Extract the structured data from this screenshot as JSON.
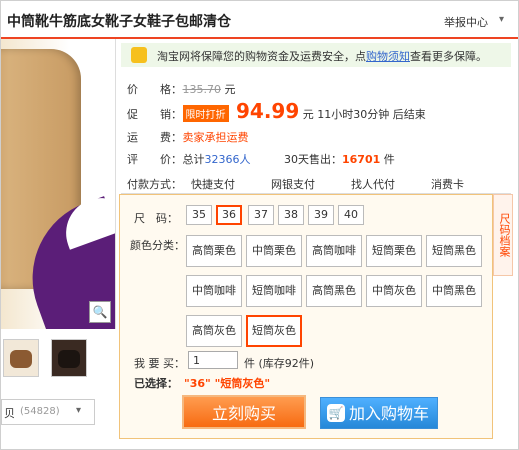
{
  "header": {
    "title": "中筒靴牛筋底女靴子女鞋子包邮清仓",
    "report": "举报中心"
  },
  "gallery": {
    "favorites_label": "贝",
    "favorites_count": "(54828)"
  },
  "guarantee": {
    "text_prefix": "淘宝网将保障您的购物资金及运费安全，点",
    "link": "购物须知",
    "text_suffix": "查看更多保障。"
  },
  "price": {
    "label": "价　　格：",
    "original": "135.70",
    "currency": "元"
  },
  "promo": {
    "label": "促　　销：",
    "badge": "限时打折",
    "price": "94.99",
    "currency": "元",
    "timer": "11小时30分钟",
    "after": "后结束"
  },
  "shipping": {
    "label": "运　　费：",
    "value": "卖家承担运费"
  },
  "reviews": {
    "label": "评　　价：",
    "prefix": "总计",
    "count": "32366人",
    "sold_label": "30天售出：",
    "sold": "16701",
    "sold_unit": "件"
  },
  "payment": {
    "label": "付款方式：",
    "options": [
      "快捷支付",
      "网银支付",
      "找人代付",
      "消费卡"
    ]
  },
  "sku": {
    "size_label": "尺　码：",
    "sizes": [
      "35",
      "36",
      "37",
      "38",
      "39",
      "40"
    ],
    "selected_size_index": 1,
    "color_label": "颜色分类：",
    "colors": [
      "高筒栗色",
      "中筒栗色",
      "高筒咖啡",
      "短筒栗色",
      "短筒黑色",
      "中筒咖啡",
      "短筒咖啡",
      "高筒黑色",
      "中筒灰色",
      "中筒黑色",
      "高筒灰色",
      "短筒灰色"
    ],
    "selected_color_index": 11,
    "qty_label": "我 要 买：",
    "qty": "1",
    "stock": "件 (库存92件)",
    "chosen_label": "已选择：",
    "chosen": "\"36\" \"短筒灰色\"",
    "buy": "立刻购买",
    "cart": "加入购物车"
  },
  "side_tag": "尺码档案"
}
